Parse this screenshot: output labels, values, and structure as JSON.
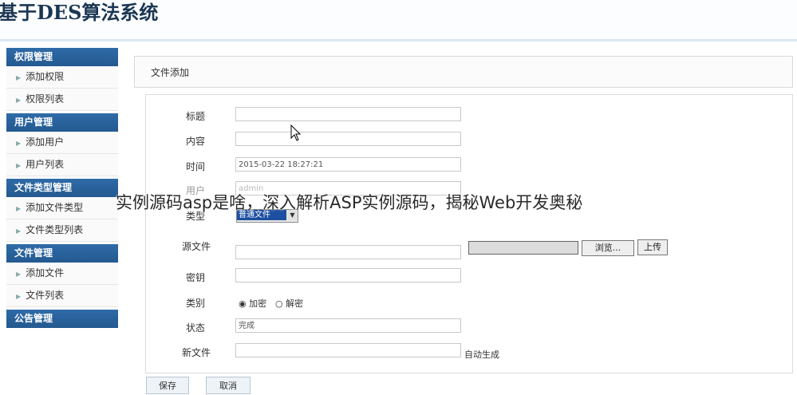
{
  "site": {
    "title": "基于DES算法系统"
  },
  "sidebar": {
    "groups": [
      {
        "title": "权限管理",
        "items": [
          "添加权限",
          "权限列表"
        ]
      },
      {
        "title": "用户管理",
        "items": [
          "添加用户",
          "用户列表"
        ]
      },
      {
        "title": "文件类型管理",
        "items": [
          "添加文件类型",
          "文件类型列表"
        ]
      },
      {
        "title": "文件管理",
        "items": [
          "添加文件",
          "文件列表"
        ]
      },
      {
        "title": "公告管理",
        "items": []
      }
    ]
  },
  "main": {
    "header": "文件添加"
  },
  "form": {
    "title_label": "标题",
    "content_label": "内容",
    "time_label": "时间",
    "time_value": "2015-03-22 18:27:21",
    "user_label": "用户",
    "user_value": "admin",
    "type_label": "类型",
    "type_value": "普通文件",
    "source_label": "源文件",
    "browse_label": "浏览...",
    "upload_label": "上传",
    "key_label": "密钥",
    "category_label": "类别",
    "option_encrypt": "加密",
    "option_decrypt": "解密",
    "status_label": "状态",
    "status_value": "完成",
    "newfile_label": "新文件",
    "newfile_note": "自动生成",
    "save_label": "保存",
    "cancel_label": "取消"
  },
  "overlay_caption": "实例源码asp是啥，深入解析ASP实例源码，揭秘Web开发奥秘"
}
